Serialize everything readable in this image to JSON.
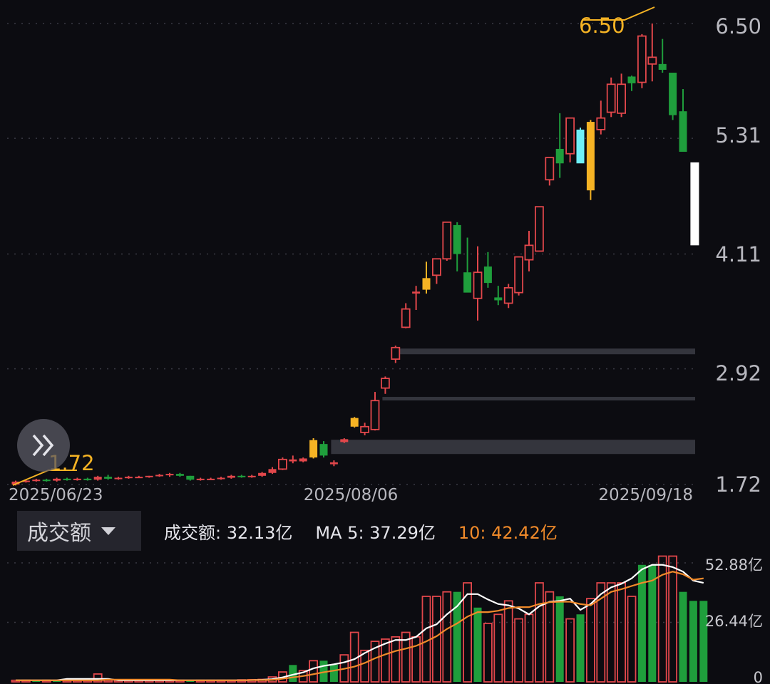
{
  "chart_data": [
    {
      "type": "candlestick",
      "y_ticks": [
        "6.50",
        "5.31",
        "4.11",
        "2.92",
        "1.72"
      ],
      "ylim": [
        1.72,
        6.5
      ],
      "x_labels": [
        "2025/06/23",
        "2025/08/06",
        "2025/09/18"
      ],
      "annotations": {
        "high": "6.50",
        "low": "1.72"
      },
      "colors": {
        "up": "#e2474b",
        "down": "#1f9e3c",
        "limit_up": "#f5b324",
        "special": "#6ff0f8"
      },
      "candles": [
        {
          "o": 1.72,
          "h": 1.76,
          "l": 1.71,
          "c": 1.75,
          "up": true
        },
        {
          "o": 1.75,
          "h": 1.77,
          "l": 1.74,
          "c": 1.76,
          "up": true
        },
        {
          "o": 1.76,
          "h": 1.78,
          "l": 1.75,
          "c": 1.77,
          "up": true
        },
        {
          "o": 1.77,
          "h": 1.78,
          "l": 1.75,
          "c": 1.76,
          "up": false
        },
        {
          "o": 1.76,
          "h": 1.79,
          "l": 1.75,
          "c": 1.78,
          "up": true
        },
        {
          "o": 1.78,
          "h": 1.79,
          "l": 1.76,
          "c": 1.77,
          "up": false
        },
        {
          "o": 1.77,
          "h": 1.79,
          "l": 1.76,
          "c": 1.78,
          "up": true
        },
        {
          "o": 1.78,
          "h": 1.79,
          "l": 1.76,
          "c": 1.77,
          "up": false
        },
        {
          "o": 1.77,
          "h": 1.81,
          "l": 1.76,
          "c": 1.8,
          "up": true
        },
        {
          "o": 1.8,
          "h": 1.82,
          "l": 1.77,
          "c": 1.78,
          "up": false
        },
        {
          "o": 1.78,
          "h": 1.8,
          "l": 1.77,
          "c": 1.79,
          "up": true
        },
        {
          "o": 1.79,
          "h": 1.81,
          "l": 1.78,
          "c": 1.8,
          "up": true
        },
        {
          "o": 1.8,
          "h": 1.81,
          "l": 1.79,
          "c": 1.8,
          "up": true
        },
        {
          "o": 1.8,
          "h": 1.81,
          "l": 1.79,
          "c": 1.81,
          "up": true
        },
        {
          "o": 1.81,
          "h": 1.83,
          "l": 1.8,
          "c": 1.82,
          "up": true
        },
        {
          "o": 1.82,
          "h": 1.84,
          "l": 1.8,
          "c": 1.83,
          "up": true
        },
        {
          "o": 1.83,
          "h": 1.84,
          "l": 1.8,
          "c": 1.81,
          "up": false
        },
        {
          "o": 1.81,
          "h": 1.81,
          "l": 1.76,
          "c": 1.77,
          "up": false
        },
        {
          "o": 1.77,
          "h": 1.79,
          "l": 1.76,
          "c": 1.78,
          "up": true
        },
        {
          "o": 1.78,
          "h": 1.79,
          "l": 1.77,
          "c": 1.78,
          "up": true
        },
        {
          "o": 1.78,
          "h": 1.8,
          "l": 1.77,
          "c": 1.79,
          "up": true
        },
        {
          "o": 1.79,
          "h": 1.82,
          "l": 1.78,
          "c": 1.81,
          "up": true
        },
        {
          "o": 1.81,
          "h": 1.82,
          "l": 1.79,
          "c": 1.8,
          "up": false
        },
        {
          "o": 1.8,
          "h": 1.82,
          "l": 1.79,
          "c": 1.81,
          "up": true
        },
        {
          "o": 1.81,
          "h": 1.85,
          "l": 1.8,
          "c": 1.84,
          "up": true
        },
        {
          "o": 1.84,
          "h": 1.9,
          "l": 1.83,
          "c": 1.88,
          "up": true
        },
        {
          "o": 1.88,
          "h": 2.0,
          "l": 1.87,
          "c": 1.98,
          "up": true
        },
        {
          "o": 1.98,
          "h": 2.02,
          "l": 1.94,
          "c": 1.96,
          "up": true
        },
        {
          "o": 1.96,
          "h": 2.0,
          "l": 1.95,
          "c": 1.99,
          "up": true
        },
        {
          "o": 2.0,
          "h": 2.2,
          "l": 1.99,
          "c": 2.18,
          "up": true,
          "limit": true
        },
        {
          "o": 2.14,
          "h": 2.17,
          "l": 2.0,
          "c": 2.02,
          "up": false
        },
        {
          "o": 1.95,
          "h": 1.97,
          "l": 1.91,
          "c": 1.93,
          "up": true
        },
        {
          "o": 2.16,
          "h": 2.2,
          "l": 2.15,
          "c": 2.19,
          "up": true
        },
        {
          "o": 2.32,
          "h": 2.42,
          "l": 2.31,
          "c": 2.41,
          "up": true,
          "limit": true
        },
        {
          "o": 2.26,
          "h": 2.36,
          "l": 2.23,
          "c": 2.32,
          "up": true
        },
        {
          "o": 2.29,
          "h": 2.68,
          "l": 2.28,
          "c": 2.59,
          "up": true
        },
        {
          "o": 2.72,
          "h": 2.84,
          "l": 2.66,
          "c": 2.82,
          "up": true
        },
        {
          "o": 3.02,
          "h": 3.16,
          "l": 2.98,
          "c": 3.14,
          "up": true
        },
        {
          "o": 3.35,
          "h": 3.6,
          "l": 3.34,
          "c": 3.54,
          "up": true
        },
        {
          "o": 3.7,
          "h": 3.78,
          "l": 3.53,
          "c": 3.72,
          "up": true
        },
        {
          "o": 3.74,
          "h": 4.03,
          "l": 3.7,
          "c": 3.86,
          "up": true,
          "limit": true
        },
        {
          "o": 3.89,
          "h": 4.06,
          "l": 3.8,
          "c": 4.06,
          "up": true
        },
        {
          "o": 4.06,
          "h": 4.44,
          "l": 4.04,
          "c": 4.44,
          "up": true
        },
        {
          "o": 4.41,
          "h": 4.44,
          "l": 3.93,
          "c": 4.11,
          "up": false
        },
        {
          "o": 3.92,
          "h": 4.28,
          "l": 3.89,
          "c": 3.71,
          "up": false
        },
        {
          "o": 3.92,
          "h": 4.19,
          "l": 3.42,
          "c": 3.65,
          "up": true
        },
        {
          "o": 3.98,
          "h": 4.13,
          "l": 3.76,
          "c": 3.81,
          "up": false
        },
        {
          "o": 3.66,
          "h": 3.78,
          "l": 3.58,
          "c": 3.63,
          "up": false
        },
        {
          "o": 3.6,
          "h": 3.8,
          "l": 3.55,
          "c": 3.76,
          "up": true
        },
        {
          "o": 3.71,
          "h": 4.08,
          "l": 3.68,
          "c": 4.08,
          "up": true
        },
        {
          "o": 4.05,
          "h": 4.35,
          "l": 3.93,
          "c": 4.2,
          "up": true
        },
        {
          "o": 4.14,
          "h": 4.6,
          "l": 4.14,
          "c": 4.6,
          "up": true
        },
        {
          "o": 4.88,
          "h": 5.1,
          "l": 4.82,
          "c": 5.11,
          "up": true
        },
        {
          "o": 5.05,
          "h": 5.57,
          "l": 4.9,
          "c": 5.2,
          "up": false
        },
        {
          "o": 5.52,
          "h": 5.52,
          "l": 5.06,
          "c": 5.15,
          "up": true
        },
        {
          "o": 5.4,
          "h": 5.42,
          "l": 5.06,
          "c": 5.05,
          "up": false,
          "special": true
        },
        {
          "o": 4.77,
          "h": 5.5,
          "l": 4.67,
          "c": 5.48,
          "up": true,
          "limit": true
        },
        {
          "o": 5.52,
          "h": 5.7,
          "l": 5.35,
          "c": 5.4,
          "up": true
        },
        {
          "o": 5.58,
          "h": 5.94,
          "l": 5.53,
          "c": 5.87,
          "up": true
        },
        {
          "o": 5.57,
          "h": 5.98,
          "l": 5.53,
          "c": 5.87,
          "up": true
        },
        {
          "o": 5.95,
          "h": 5.96,
          "l": 5.8,
          "c": 5.88,
          "up": false
        },
        {
          "o": 5.89,
          "h": 6.39,
          "l": 5.83,
          "c": 6.37,
          "up": true
        },
        {
          "o": 6.15,
          "h": 6.5,
          "l": 5.9,
          "c": 6.08,
          "up": true
        },
        {
          "o": 6.08,
          "h": 6.34,
          "l": 5.99,
          "c": 6.02,
          "up": false
        },
        {
          "o": 5.99,
          "h": 5.85,
          "l": 5.5,
          "c": 5.55,
          "up": false
        },
        {
          "o": 5.59,
          "h": 5.82,
          "l": 5.19,
          "c": 5.17,
          "up": false
        },
        {
          "o": 5.06,
          "h": 5.06,
          "l": 4.2,
          "c": 4.2,
          "up": true,
          "current": true
        }
      ],
      "support_levels": [
        3.1,
        2.61,
        2.11
      ]
    },
    {
      "type": "bar",
      "title": "成交额",
      "y_ticks": [
        "52.88亿",
        "26.44亿",
        "0"
      ],
      "ylim": [
        0,
        52.88
      ],
      "values": [
        0.7,
        0.7,
        0.7,
        0.7,
        0.7,
        0.7,
        0.7,
        0.7,
        3.5,
        0.7,
        0.7,
        0.7,
        0.7,
        0.7,
        0.7,
        0.7,
        0.7,
        0.7,
        0.7,
        0.7,
        0.7,
        0.7,
        0.9,
        1.0,
        1.1,
        2.2,
        4.4,
        7.5,
        5.0,
        9.4,
        9.4,
        7.6,
        12.0,
        22.0,
        14.0,
        18.0,
        19.0,
        20.0,
        22.0,
        20.0,
        38.0,
        38.0,
        40.0,
        40.0,
        44.0,
        33.0,
        26.0,
        30.0,
        36.0,
        28.0,
        30.0,
        44.0,
        40.0,
        38.0,
        28.0,
        30.0,
        37.0,
        44.0,
        44.0,
        44.0,
        38.0,
        52.0,
        52.0,
        58.0,
        56.0,
        40.0,
        36.0,
        36.0
      ],
      "up_flags": [
        true,
        true,
        false,
        true,
        false,
        true,
        true,
        true,
        true,
        true,
        true,
        true,
        true,
        true,
        true,
        true,
        true,
        false,
        true,
        true,
        true,
        true,
        true,
        true,
        true,
        true,
        true,
        false,
        true,
        true,
        false,
        false,
        true,
        true,
        true,
        true,
        true,
        true,
        true,
        true,
        true,
        true,
        true,
        false,
        true,
        false,
        true,
        true,
        true,
        true,
        true,
        true,
        true,
        false,
        true,
        false,
        true,
        true,
        true,
        true,
        true,
        false,
        false,
        true,
        true,
        false,
        false,
        false
      ],
      "series": [
        {
          "name": "MA 5",
          "values": [
            0.7,
            0.7,
            0.7,
            0.7,
            0.7,
            1.3,
            1.3,
            1.3,
            1.3,
            1.3,
            0.7,
            0.7,
            0.7,
            0.7,
            0.7,
            0.7,
            0.7,
            0.7,
            0.7,
            0.7,
            0.7,
            0.7,
            0.7,
            0.8,
            0.9,
            1.2,
            2.0,
            3.2,
            4.2,
            6.0,
            7.1,
            7.8,
            8.7,
            10.1,
            12.8,
            15.1,
            17.0,
            18.6,
            18.6,
            20.0,
            23.8,
            25.6,
            30.0,
            33.6,
            39.0,
            39.0,
            36.6,
            34.6,
            34.0,
            32.6,
            30.0,
            33.6,
            35.6,
            36.0,
            37.0,
            32.0,
            34.6,
            39.0,
            42.0,
            43.6,
            46.0,
            50.0,
            52.0,
            52.0,
            51.0,
            49.0,
            45.0,
            44.0
          ]
        },
        {
          "name": "10",
          "values": [
            0.7,
            0.7,
            0.7,
            0.7,
            0.7,
            0.7,
            0.7,
            0.7,
            0.7,
            1.0,
            1.0,
            1.0,
            1.0,
            1.0,
            1.0,
            1.0,
            0.7,
            0.7,
            0.7,
            0.7,
            0.7,
            0.7,
            0.7,
            0.8,
            0.8,
            0.9,
            1.4,
            2.0,
            2.6,
            3.4,
            4.3,
            5.0,
            5.8,
            6.8,
            8.4,
            10.5,
            12.2,
            13.7,
            14.8,
            16.0,
            18.0,
            20.3,
            23.5,
            26.0,
            29.0,
            31.0,
            31.0,
            31.6,
            32.8,
            33.2,
            33.2,
            34.6,
            35.4,
            35.6,
            35.6,
            34.6,
            34.0,
            37.0,
            40.0,
            41.2,
            42.6,
            44.0,
            45.0,
            47.6,
            49.0,
            47.8,
            45.4,
            46.0
          ]
        }
      ]
    }
  ],
  "volume_panel": {
    "selector_label": "成交额",
    "turnover_label": "成交额: 32.13亿",
    "ma5_label": "MA 5: 37.29亿",
    "ma10_label": "10: 42.42亿",
    "ma5_color": "#ffffff",
    "ma10_color": "#f08a2a"
  },
  "icons": {
    "expand": "double-chevron-right-icon",
    "selector": "caret-down-icon"
  }
}
